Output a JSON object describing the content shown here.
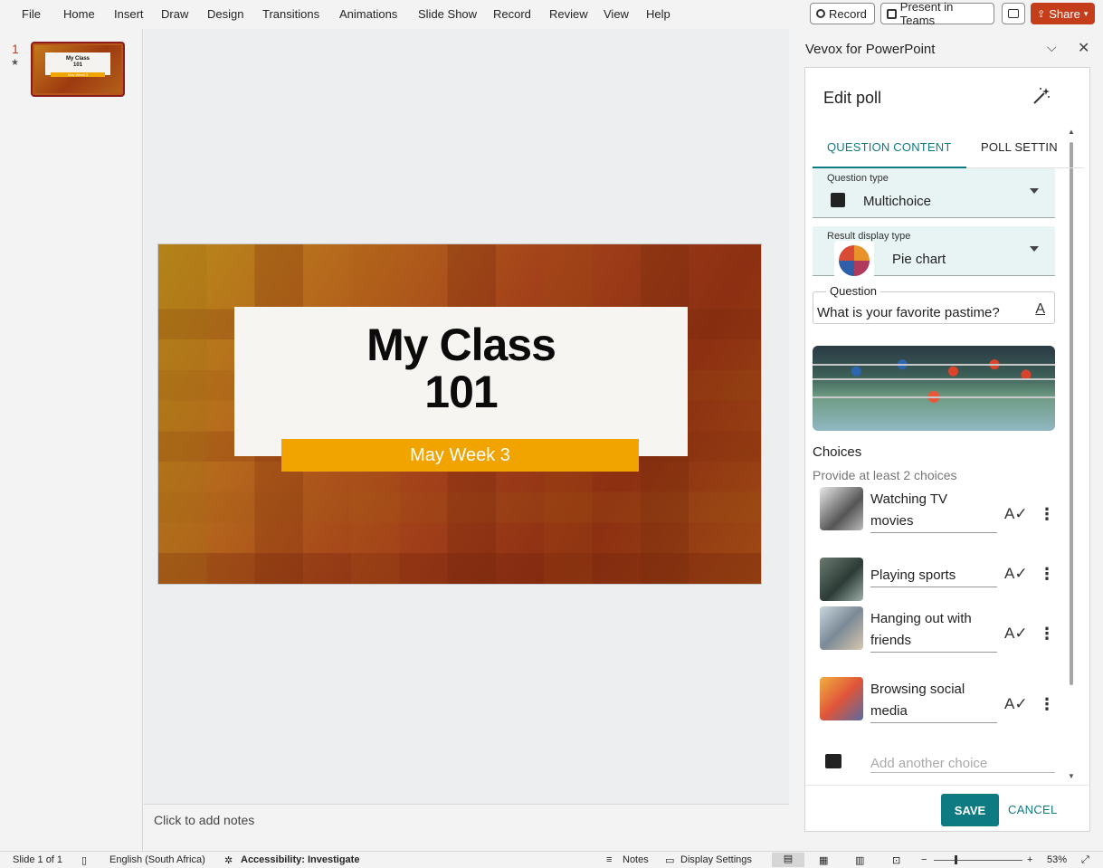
{
  "ribbon": {
    "tabs": [
      "File",
      "Home",
      "Insert",
      "Draw",
      "Design",
      "Transitions",
      "Animations",
      "Slide Show",
      "Record",
      "Review",
      "View",
      "Help"
    ],
    "record_label": "Record",
    "present_label": "Present in Teams",
    "share_label": "Share"
  },
  "thumbnails": {
    "number": "1",
    "star": "★",
    "title_line1": "My Class",
    "title_line2": "101",
    "subtitle": "May Week 3"
  },
  "slide": {
    "title_line1": "My Class",
    "title_line2": "101",
    "subtitle": "May Week 3"
  },
  "notes": {
    "placeholder": "Click to add notes"
  },
  "pane": {
    "title": "Vevox for PowerPoint",
    "heading": "Edit poll",
    "tabs": [
      "QUESTION CONTENT",
      "POLL SETTIN"
    ],
    "question_type": {
      "label": "Question type",
      "value": "Multichoice"
    },
    "result_display": {
      "label": "Result display type",
      "value": "Pie chart"
    },
    "question": {
      "label": "Question",
      "value": "What is your favorite pastime?"
    },
    "choices_heading": "Choices",
    "choices_hint": "Provide at least 2 choices",
    "choices": [
      {
        "line1": "Watching TV",
        "line2": "movies"
      },
      {
        "line1": "Playing sports",
        "line2": ""
      },
      {
        "line1": "Hanging out with",
        "line2": "friends"
      },
      {
        "line1": "Browsing social",
        "line2": "media"
      }
    ],
    "add_choice_placeholder": "Add another choice",
    "save_label": "SAVE",
    "cancel_label": "CANCEL"
  },
  "status": {
    "slide_info": "Slide 1 of 1",
    "language": "English (South Africa)",
    "accessibility": "Accessibility: Investigate",
    "notes": "Notes",
    "display_settings": "Display Settings",
    "zoom": "53%"
  },
  "colors": {
    "accent": "#0e7b82",
    "share": "#c43e1c",
    "subtitle_bar": "#f1a300"
  }
}
